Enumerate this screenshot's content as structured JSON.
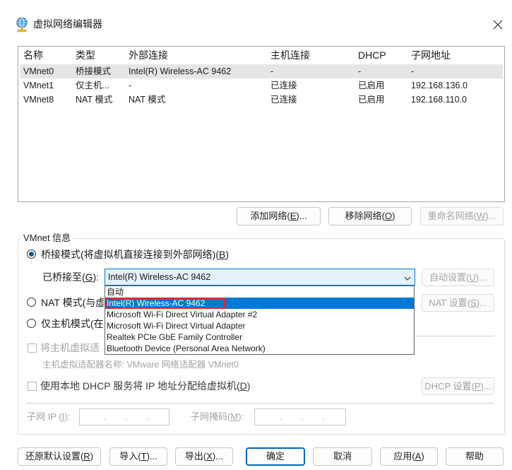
{
  "window": {
    "title": "虚拟网络编辑器",
    "icon": "network-globe-icon",
    "close_icon": "close-icon"
  },
  "network_table": {
    "columns": [
      "名称",
      "类型",
      "外部连接",
      "主机连接",
      "DHCP",
      "子网地址"
    ],
    "rows": [
      [
        "VMnet0",
        "桥接模式",
        "Intel(R) Wireless-AC 9462",
        "-",
        "-",
        "-"
      ],
      [
        "VMnet1",
        "仅主机...",
        "-",
        "已连接",
        "已启用",
        "192.168.136.0"
      ],
      [
        "VMnet8",
        "NAT 模式",
        "NAT 模式",
        "已连接",
        "已启用",
        "192.168.110.0"
      ]
    ],
    "selected_row": 0
  },
  "table_actions": {
    "add_network": "添加网络(E)...",
    "remove_network": "移除网络(O)",
    "rename_network": "重命名网络(W)..."
  },
  "vmnet_info": {
    "group_label": "VMnet 信息",
    "bridged": {
      "label": "桥接模式(将虚拟机直接连接到外部网络)(B)",
      "checked": true
    },
    "bridged_to": {
      "label": "已桥接至(G):",
      "value": "Intel(R) Wireless-AC 9462",
      "chevron_icon": "chevron-down-icon",
      "options": [
        "自动",
        "Intel(R) Wireless-AC 9462",
        "Microsoft Wi-Fi Direct Virtual Adapter #2",
        "Microsoft Wi-Fi Direct Virtual Adapter",
        "Realtek PCIe GbE Family Controller",
        "Bluetooth Device (Personal Area Network)"
      ],
      "highlighted_option": 1
    },
    "auto_settings_button": "自动设置(U)...",
    "nat": {
      "label": "NAT 模式(与虚",
      "checked": false
    },
    "nat_settings_button": "NAT 设置(S)...",
    "host_only": {
      "label": "仅主机模式(在",
      "checked": false
    },
    "connect_host_adapter": {
      "label": "将主机虚拟适",
      "checked": false
    },
    "host_adapter_name": "主机虚拟适配器名称: VMware 网络适配器 VMnet0",
    "use_local_dhcp": {
      "label": "使用本地 DHCP 服务将 IP 地址分配给虚拟机(D)",
      "checked": false
    },
    "dhcp_settings_button": "DHCP 设置(P)...",
    "subnet_ip": {
      "label": "子网 IP (I):",
      "octets": [
        "",
        "",
        "",
        ""
      ],
      "separator": "."
    },
    "subnet_mask": {
      "label": "子网掩码(M):",
      "octets": [
        "",
        "",
        "",
        ""
      ],
      "separator": "."
    }
  },
  "footer_buttons": {
    "restore_defaults": "还原默认设置(R)",
    "import": "导入(T)...",
    "export": "导出(X)...",
    "ok": "确定",
    "cancel": "取消",
    "apply": "应用(A)",
    "help": "帮助"
  },
  "colors": {
    "accent": "#0078d7",
    "selection": "#0078d7",
    "row_selected_bg": "#e5e5e5",
    "annotation_red": "#e3262e",
    "disabled_text": "#a3a3a3",
    "primary_border": "#0067c0",
    "combo_bg": "#e5f1fb"
  }
}
